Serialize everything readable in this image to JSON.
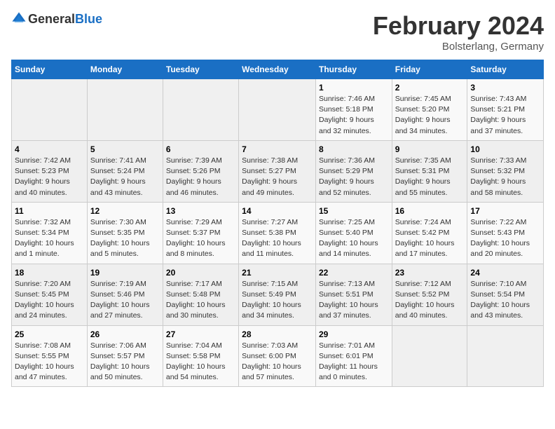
{
  "header": {
    "logo_general": "General",
    "logo_blue": "Blue",
    "month_title": "February 2024",
    "location": "Bolsterlang, Germany"
  },
  "days_of_week": [
    "Sunday",
    "Monday",
    "Tuesday",
    "Wednesday",
    "Thursday",
    "Friday",
    "Saturday"
  ],
  "weeks": [
    [
      {
        "day": "",
        "info": ""
      },
      {
        "day": "",
        "info": ""
      },
      {
        "day": "",
        "info": ""
      },
      {
        "day": "",
        "info": ""
      },
      {
        "day": "1",
        "info": "Sunrise: 7:46 AM\nSunset: 5:18 PM\nDaylight: 9 hours\nand 32 minutes."
      },
      {
        "day": "2",
        "info": "Sunrise: 7:45 AM\nSunset: 5:20 PM\nDaylight: 9 hours\nand 34 minutes."
      },
      {
        "day": "3",
        "info": "Sunrise: 7:43 AM\nSunset: 5:21 PM\nDaylight: 9 hours\nand 37 minutes."
      }
    ],
    [
      {
        "day": "4",
        "info": "Sunrise: 7:42 AM\nSunset: 5:23 PM\nDaylight: 9 hours\nand 40 minutes."
      },
      {
        "day": "5",
        "info": "Sunrise: 7:41 AM\nSunset: 5:24 PM\nDaylight: 9 hours\nand 43 minutes."
      },
      {
        "day": "6",
        "info": "Sunrise: 7:39 AM\nSunset: 5:26 PM\nDaylight: 9 hours\nand 46 minutes."
      },
      {
        "day": "7",
        "info": "Sunrise: 7:38 AM\nSunset: 5:27 PM\nDaylight: 9 hours\nand 49 minutes."
      },
      {
        "day": "8",
        "info": "Sunrise: 7:36 AM\nSunset: 5:29 PM\nDaylight: 9 hours\nand 52 minutes."
      },
      {
        "day": "9",
        "info": "Sunrise: 7:35 AM\nSunset: 5:31 PM\nDaylight: 9 hours\nand 55 minutes."
      },
      {
        "day": "10",
        "info": "Sunrise: 7:33 AM\nSunset: 5:32 PM\nDaylight: 9 hours\nand 58 minutes."
      }
    ],
    [
      {
        "day": "11",
        "info": "Sunrise: 7:32 AM\nSunset: 5:34 PM\nDaylight: 10 hours\nand 1 minute."
      },
      {
        "day": "12",
        "info": "Sunrise: 7:30 AM\nSunset: 5:35 PM\nDaylight: 10 hours\nand 5 minutes."
      },
      {
        "day": "13",
        "info": "Sunrise: 7:29 AM\nSunset: 5:37 PM\nDaylight: 10 hours\nand 8 minutes."
      },
      {
        "day": "14",
        "info": "Sunrise: 7:27 AM\nSunset: 5:38 PM\nDaylight: 10 hours\nand 11 minutes."
      },
      {
        "day": "15",
        "info": "Sunrise: 7:25 AM\nSunset: 5:40 PM\nDaylight: 10 hours\nand 14 minutes."
      },
      {
        "day": "16",
        "info": "Sunrise: 7:24 AM\nSunset: 5:42 PM\nDaylight: 10 hours\nand 17 minutes."
      },
      {
        "day": "17",
        "info": "Sunrise: 7:22 AM\nSunset: 5:43 PM\nDaylight: 10 hours\nand 20 minutes."
      }
    ],
    [
      {
        "day": "18",
        "info": "Sunrise: 7:20 AM\nSunset: 5:45 PM\nDaylight: 10 hours\nand 24 minutes."
      },
      {
        "day": "19",
        "info": "Sunrise: 7:19 AM\nSunset: 5:46 PM\nDaylight: 10 hours\nand 27 minutes."
      },
      {
        "day": "20",
        "info": "Sunrise: 7:17 AM\nSunset: 5:48 PM\nDaylight: 10 hours\nand 30 minutes."
      },
      {
        "day": "21",
        "info": "Sunrise: 7:15 AM\nSunset: 5:49 PM\nDaylight: 10 hours\nand 34 minutes."
      },
      {
        "day": "22",
        "info": "Sunrise: 7:13 AM\nSunset: 5:51 PM\nDaylight: 10 hours\nand 37 minutes."
      },
      {
        "day": "23",
        "info": "Sunrise: 7:12 AM\nSunset: 5:52 PM\nDaylight: 10 hours\nand 40 minutes."
      },
      {
        "day": "24",
        "info": "Sunrise: 7:10 AM\nSunset: 5:54 PM\nDaylight: 10 hours\nand 43 minutes."
      }
    ],
    [
      {
        "day": "25",
        "info": "Sunrise: 7:08 AM\nSunset: 5:55 PM\nDaylight: 10 hours\nand 47 minutes."
      },
      {
        "day": "26",
        "info": "Sunrise: 7:06 AM\nSunset: 5:57 PM\nDaylight: 10 hours\nand 50 minutes."
      },
      {
        "day": "27",
        "info": "Sunrise: 7:04 AM\nSunset: 5:58 PM\nDaylight: 10 hours\nand 54 minutes."
      },
      {
        "day": "28",
        "info": "Sunrise: 7:03 AM\nSunset: 6:00 PM\nDaylight: 10 hours\nand 57 minutes."
      },
      {
        "day": "29",
        "info": "Sunrise: 7:01 AM\nSunset: 6:01 PM\nDaylight: 11 hours\nand 0 minutes."
      },
      {
        "day": "",
        "info": ""
      },
      {
        "day": "",
        "info": ""
      }
    ]
  ]
}
